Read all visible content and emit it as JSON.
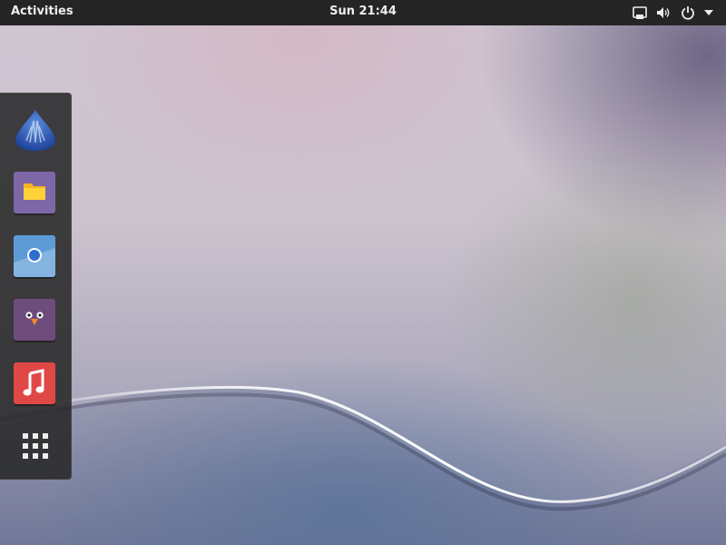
{
  "topbar": {
    "activities_label": "Activities",
    "clock": "Sun 21:44",
    "tray_icons": [
      "network-icon",
      "volume-icon",
      "power-icon",
      "dropdown-arrow-icon"
    ]
  },
  "dash": {
    "apps": [
      {
        "name": "app-launcher-1",
        "icon": "blue-drop-icon"
      },
      {
        "name": "files",
        "icon": "folder-icon"
      },
      {
        "name": "web-browser",
        "icon": "browser-icon"
      },
      {
        "name": "chat-client",
        "icon": "owl-icon"
      },
      {
        "name": "music-player",
        "icon": "music-note-icon"
      }
    ],
    "show_apps_icon": "grid-icon"
  },
  "colors": {
    "topbar": "#252525",
    "dash": "#2b2b2b",
    "files_tile": "#7d67a7",
    "browser_tile": "#5c9bd6",
    "chat_tile": "#6e4c7b",
    "music_tile": "#e04848"
  }
}
